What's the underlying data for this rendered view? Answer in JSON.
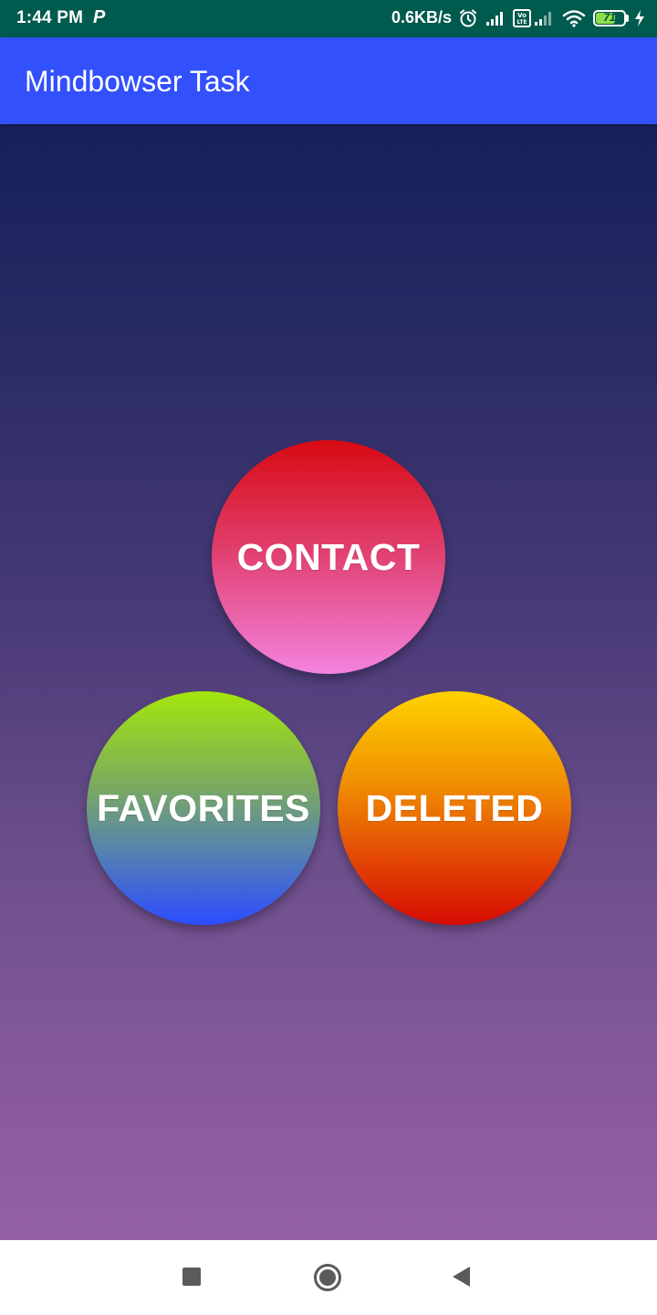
{
  "status_bar": {
    "time": "1:44 PM",
    "notification_icon": "P",
    "network_speed": "0.6KB/s",
    "icons": [
      "alarm-icon",
      "signal-icon",
      "volte-icon",
      "signal-icon",
      "wifi-icon",
      "battery-icon",
      "charging-icon"
    ],
    "battery_level": "71",
    "battery_percent": 71
  },
  "app_bar": {
    "title": "Mindbowser Task",
    "color": "#3250fb"
  },
  "buttons": {
    "contact": {
      "label": "CONTACT",
      "colors": [
        "#d80a12",
        "#f383df"
      ]
    },
    "favorites": {
      "label": "FAVORITES",
      "colors": [
        "#a4e60c",
        "#2c4cff"
      ]
    },
    "deleted": {
      "label": "DELETED",
      "colors": [
        "#ffd200",
        "#d60a02"
      ]
    }
  },
  "nav_bar": {
    "items": [
      "recents-square-icon",
      "home-circle-icon",
      "back-triangle-icon"
    ]
  }
}
